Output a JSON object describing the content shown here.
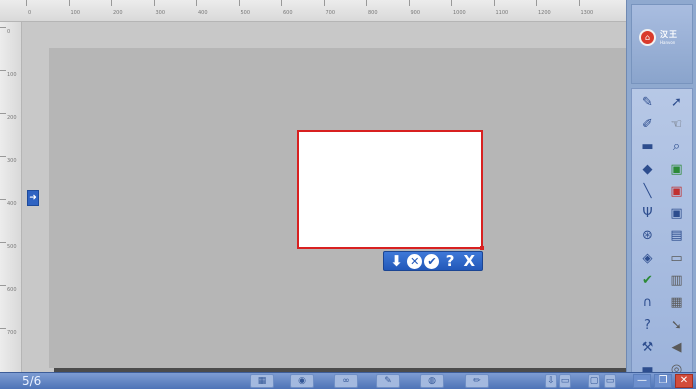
{
  "ruler": {
    "top_ticks": [
      "0",
      "100",
      "200",
      "300",
      "400",
      "500",
      "600",
      "700",
      "800",
      "900",
      "1000",
      "1100",
      "1200",
      "1300"
    ],
    "left_ticks": [
      "0",
      "100",
      "200",
      "300",
      "400",
      "500",
      "600",
      "700"
    ]
  },
  "side_tab": {
    "icon": "arrow-right-icon"
  },
  "selection_toolbar": {
    "buttons": [
      {
        "name": "download-icon",
        "glyph": "⬇"
      },
      {
        "name": "cancel-circle-icon",
        "glyph": "✕"
      },
      {
        "name": "confirm-circle-icon",
        "glyph": "✔"
      },
      {
        "name": "help-icon",
        "glyph": "?"
      },
      {
        "name": "close-icon",
        "glyph": "X"
      }
    ]
  },
  "logo": {
    "mark": "⌂",
    "text": "汉王",
    "sub": "Hanvon"
  },
  "tools": [
    {
      "name": "pen-icon",
      "glyph": "✎"
    },
    {
      "name": "pointer-icon",
      "glyph": "➚"
    },
    {
      "name": "texture-pen-icon",
      "glyph": "✐"
    },
    {
      "name": "hand-icon",
      "glyph": "☜"
    },
    {
      "name": "eraser-icon",
      "glyph": "▬"
    },
    {
      "name": "magnifier-icon",
      "glyph": "⌕"
    },
    {
      "name": "fill-bucket-icon",
      "glyph": "◆"
    },
    {
      "name": "save-add-icon",
      "glyph": "▣"
    },
    {
      "name": "line-icon",
      "glyph": "╲"
    },
    {
      "name": "save-delete-icon",
      "glyph": "▣"
    },
    {
      "name": "trident-icon",
      "glyph": "Ψ"
    },
    {
      "name": "save-icon",
      "glyph": "▣"
    },
    {
      "name": "shapes-icon",
      "glyph": "⊛"
    },
    {
      "name": "disk-icon",
      "glyph": "▤"
    },
    {
      "name": "layers-icon",
      "glyph": "◈"
    },
    {
      "name": "screen-icon",
      "glyph": "▭"
    },
    {
      "name": "check-brush-icon",
      "glyph": "✔"
    },
    {
      "name": "paste-icon",
      "glyph": "▥"
    },
    {
      "name": "compass-icon",
      "glyph": "∩"
    },
    {
      "name": "document-icon",
      "glyph": "▦"
    },
    {
      "name": "help-circle-icon",
      "glyph": "?"
    },
    {
      "name": "cursor-select-icon",
      "glyph": "➘"
    },
    {
      "name": "tools-icon",
      "glyph": "⚒"
    },
    {
      "name": "back-icon",
      "glyph": "◀"
    },
    {
      "name": "folder-icon",
      "glyph": "▬"
    },
    {
      "name": "record-icon",
      "glyph": "◎"
    }
  ],
  "bottom_bar": {
    "page_indicator": "5/6",
    "buttons": [
      "▦",
      "◉",
      "∞",
      "✎",
      "◍",
      "✏"
    ],
    "right_controls": [
      "⇩",
      "▭",
      "▢",
      "▭"
    ],
    "window": {
      "minimize": "—",
      "restore": "❐",
      "close": "✕"
    }
  }
}
